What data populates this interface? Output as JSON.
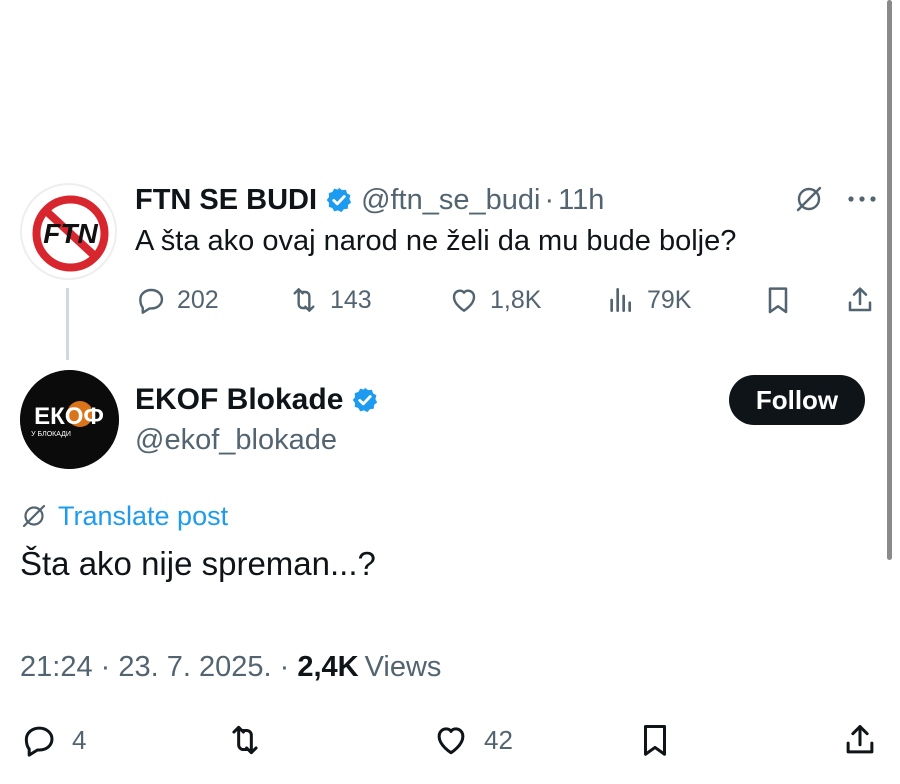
{
  "parent_post": {
    "name": "FTN SE BUDI",
    "handle": "@ftn_se_budi",
    "separator": "·",
    "time": "11h",
    "text": "A šta ako ovaj narod ne želi da mu bude bolje?",
    "avatar_text": "FTN",
    "replies": "202",
    "reposts": "143",
    "likes": "1,8K",
    "views": "79K"
  },
  "reply_post": {
    "name": "EKOF Blokade",
    "handle": "@ekof_blokade",
    "follow_label": "Follow",
    "translate_label": "Translate post",
    "text": "Šta ako nije spreman...?",
    "avatar_text": "ЕКОФ",
    "avatar_subtext": "У БЛОКАДИ",
    "timestamp": "21:24 · 23. 7. 2025. · ",
    "views_count": "2,4K",
    "views_label": "Views",
    "replies": "4",
    "likes": "42"
  },
  "colors": {
    "verified_badge": "#1d9bf0",
    "link": "#1d9bf0",
    "secondary_text": "#536471",
    "button_bg": "#0f1419",
    "ftn_red": "#d7262d"
  }
}
